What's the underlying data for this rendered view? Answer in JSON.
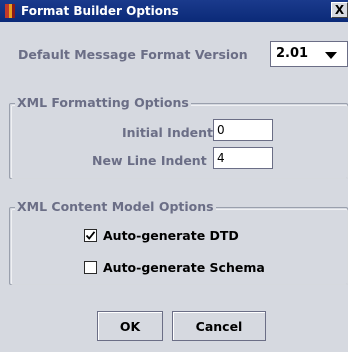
{
  "window": {
    "title": "Format Builder Options",
    "close_glyph": "X"
  },
  "version": {
    "label": "Default Message Format Version",
    "selected": "2.01"
  },
  "xml_formatting": {
    "title": "XML Formatting Options",
    "initial_indent_label": "Initial Indent",
    "initial_indent_value": "0",
    "new_line_indent_label": "New Line Indent",
    "new_line_indent_value": "4"
  },
  "xml_content_model": {
    "title": "XML Content Model Options",
    "auto_dtd_label": "Auto-generate DTD",
    "auto_dtd_checked": true,
    "auto_schema_label": "Auto-generate Schema",
    "auto_schema_checked": false
  },
  "buttons": {
    "ok": "OK",
    "cancel": "Cancel"
  },
  "colors": {
    "titlebar": "#0b2a78",
    "panel": "#d6d9e0",
    "label_text": "#6b6e86"
  }
}
